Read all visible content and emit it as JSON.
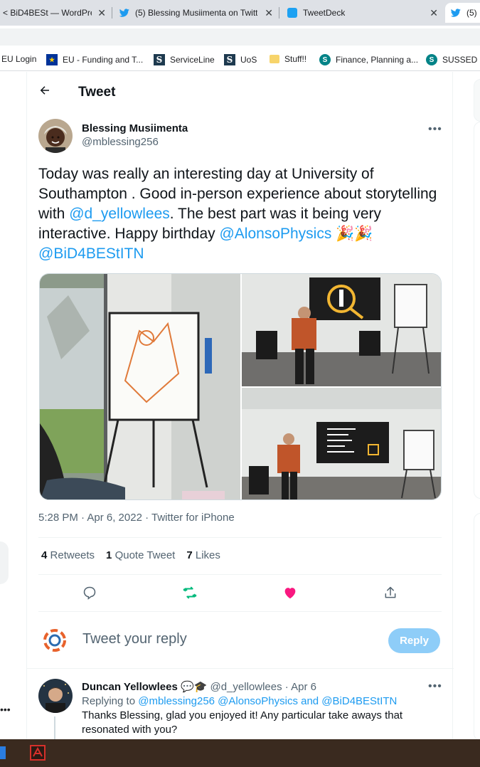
{
  "browser": {
    "tabs": [
      {
        "title": "< BiD4BESt — WordPre",
        "icon": "wordpress-icon"
      },
      {
        "title": "(5) Blessing Musiimenta on Twitt",
        "icon": "twitter-bird-icon"
      },
      {
        "title": "TweetDeck",
        "icon": "tweetdeck-icon"
      },
      {
        "title": "(5)",
        "icon": "twitter-bird-icon"
      }
    ],
    "bookmarks": [
      {
        "label": "EU Login",
        "icon": ""
      },
      {
        "label": "EU - Funding and T...",
        "icon": "eu-flag-icon"
      },
      {
        "label": "ServiceLine",
        "icon": "s-icon"
      },
      {
        "label": "UoS",
        "icon": "s-icon"
      },
      {
        "label": "Stuff!!",
        "icon": "folder-icon"
      },
      {
        "label": "Finance, Planning a...",
        "icon": "sharepoint-icon"
      },
      {
        "label": "SUSSED",
        "icon": "sharepoint-icon"
      }
    ]
  },
  "header": {
    "back_icon": "back-arrow-icon",
    "title": "Tweet"
  },
  "tweet": {
    "author_name": "Blessing Musiimenta",
    "author_handle": "@mblessing256",
    "text_part1": "Today was really an interesting day at University of Southampton . Good in-person experience about storytelling with ",
    "mention1": "@d_yellowlees",
    "text_part2": ". The best part was it being very interactive. Happy birthday ",
    "mention2": "@AlonsoPhysics",
    "emoji": "🎉🎉",
    "mention3": "@BiD4BEStITN",
    "timestamp": "5:28 PM · Apr 6, 2022 · Twitter for iPhone",
    "retweets_count": "4",
    "retweets_label": "Retweets",
    "quotes_count": "1",
    "quotes_label": "Quote Tweet",
    "likes_count": "7",
    "likes_label": "Likes"
  },
  "reply_box": {
    "placeholder": "Tweet your reply",
    "button": "Reply"
  },
  "comment": {
    "name": "Duncan Yellowlees",
    "badges": "💬🎓",
    "handle_date": "@d_yellowlees · Apr 6",
    "replying_prefix": "Replying to ",
    "replying_to": "@mblessing256 @AlonsoPhysics and @BiD4BEStITN",
    "text": "Thanks Blessing, glad you enjoyed it! Any particular take aways that resonated with you?"
  },
  "colors": {
    "accent": "#1d9bf0",
    "retweet": "#00ba7c",
    "like": "#f91880",
    "reply_btn": "#8ecdf8"
  }
}
